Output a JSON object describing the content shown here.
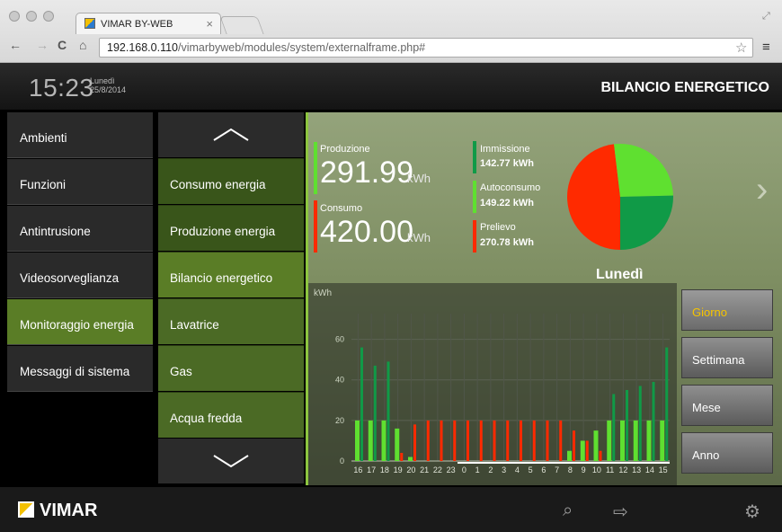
{
  "browser": {
    "tab_title": "VIMAR BY-WEB",
    "url_host": "192.168.0.110",
    "url_path": "/vimarbyweb/modules/system/externalframe.php#"
  },
  "topbar": {
    "time": "15:23",
    "weekday": "Lunedì",
    "date": "25/8/2014",
    "title": "BILANCIO ENERGETICO"
  },
  "left_menu": [
    {
      "label": "Ambienti"
    },
    {
      "label": "Funzioni"
    },
    {
      "label": "Antintrusione"
    },
    {
      "label": "Videosorveglianza"
    },
    {
      "label": "Monitoraggio energia",
      "active": true
    },
    {
      "label": "Messaggi di sistema"
    }
  ],
  "sub_menu": [
    {
      "label": "Consumo energia"
    },
    {
      "label": "Produzione energia"
    },
    {
      "label": "Bilancio energetico",
      "active": true
    },
    {
      "label": "Lavatrice"
    },
    {
      "label": "Gas"
    },
    {
      "label": "Acqua fredda"
    }
  ],
  "summary": {
    "produzione_label": "Produzione",
    "produzione_value": "291.99",
    "consumo_label": "Consumo",
    "consumo_value": "420.00",
    "unit": "kWh",
    "immissione_label": "Immissione",
    "immissione_value": "142.77 kWh",
    "autoconsumo_label": "Autoconsumo",
    "autoconsumo_value": "149.22 kWh",
    "prelievo_label": "Prelievo",
    "prelievo_value": "270.78 kWh"
  },
  "colors": {
    "immissione": "#109a47",
    "autoconsumo": "#5fe030",
    "prelievo": "#ff2a00",
    "accent": "#5a7d26",
    "selected_button": "#f5c400"
  },
  "period_buttons": [
    "Giorno",
    "Settimana",
    "Mese",
    "Anno"
  ],
  "footer": {
    "brand": "VIMAR"
  },
  "chart_data": {
    "type": "bar",
    "title": "Lunedì",
    "ylabel": "kWh",
    "ylim": [
      0,
      70
    ],
    "yticks": [
      0,
      20,
      40,
      60
    ],
    "categories": [
      "16",
      "17",
      "18",
      "19",
      "20",
      "21",
      "22",
      "23",
      "0",
      "1",
      "2",
      "3",
      "4",
      "5",
      "6",
      "7",
      "8",
      "9",
      "10",
      "11",
      "12",
      "13",
      "14",
      "15"
    ],
    "series": [
      {
        "name": "Immissione",
        "values": [
          36,
          27,
          29,
          0,
          0,
          0,
          0,
          0,
          0,
          0,
          0,
          0,
          0,
          0,
          0,
          0,
          0,
          0,
          0,
          13,
          15,
          17,
          19,
          36
        ]
      },
      {
        "name": "Autoconsumo",
        "values": [
          20,
          20,
          20,
          16,
          2,
          0,
          0,
          0,
          0,
          0,
          0,
          0,
          0,
          0,
          0,
          0,
          5,
          10,
          15,
          20,
          20,
          20,
          20,
          20
        ]
      },
      {
        "name": "Prelievo",
        "values": [
          0,
          0,
          0,
          4,
          18,
          20,
          20,
          20,
          20,
          20,
          20,
          20,
          20,
          20,
          20,
          20,
          15,
          10,
          5,
          0,
          0,
          0,
          0,
          0
        ]
      }
    ],
    "pie": {
      "slices": [
        {
          "name": "Prelievo",
          "value": 270.78
        },
        {
          "name": "Autoconsumo",
          "value": 149.22
        },
        {
          "name": "Immissione",
          "value": 142.77
        }
      ]
    }
  }
}
